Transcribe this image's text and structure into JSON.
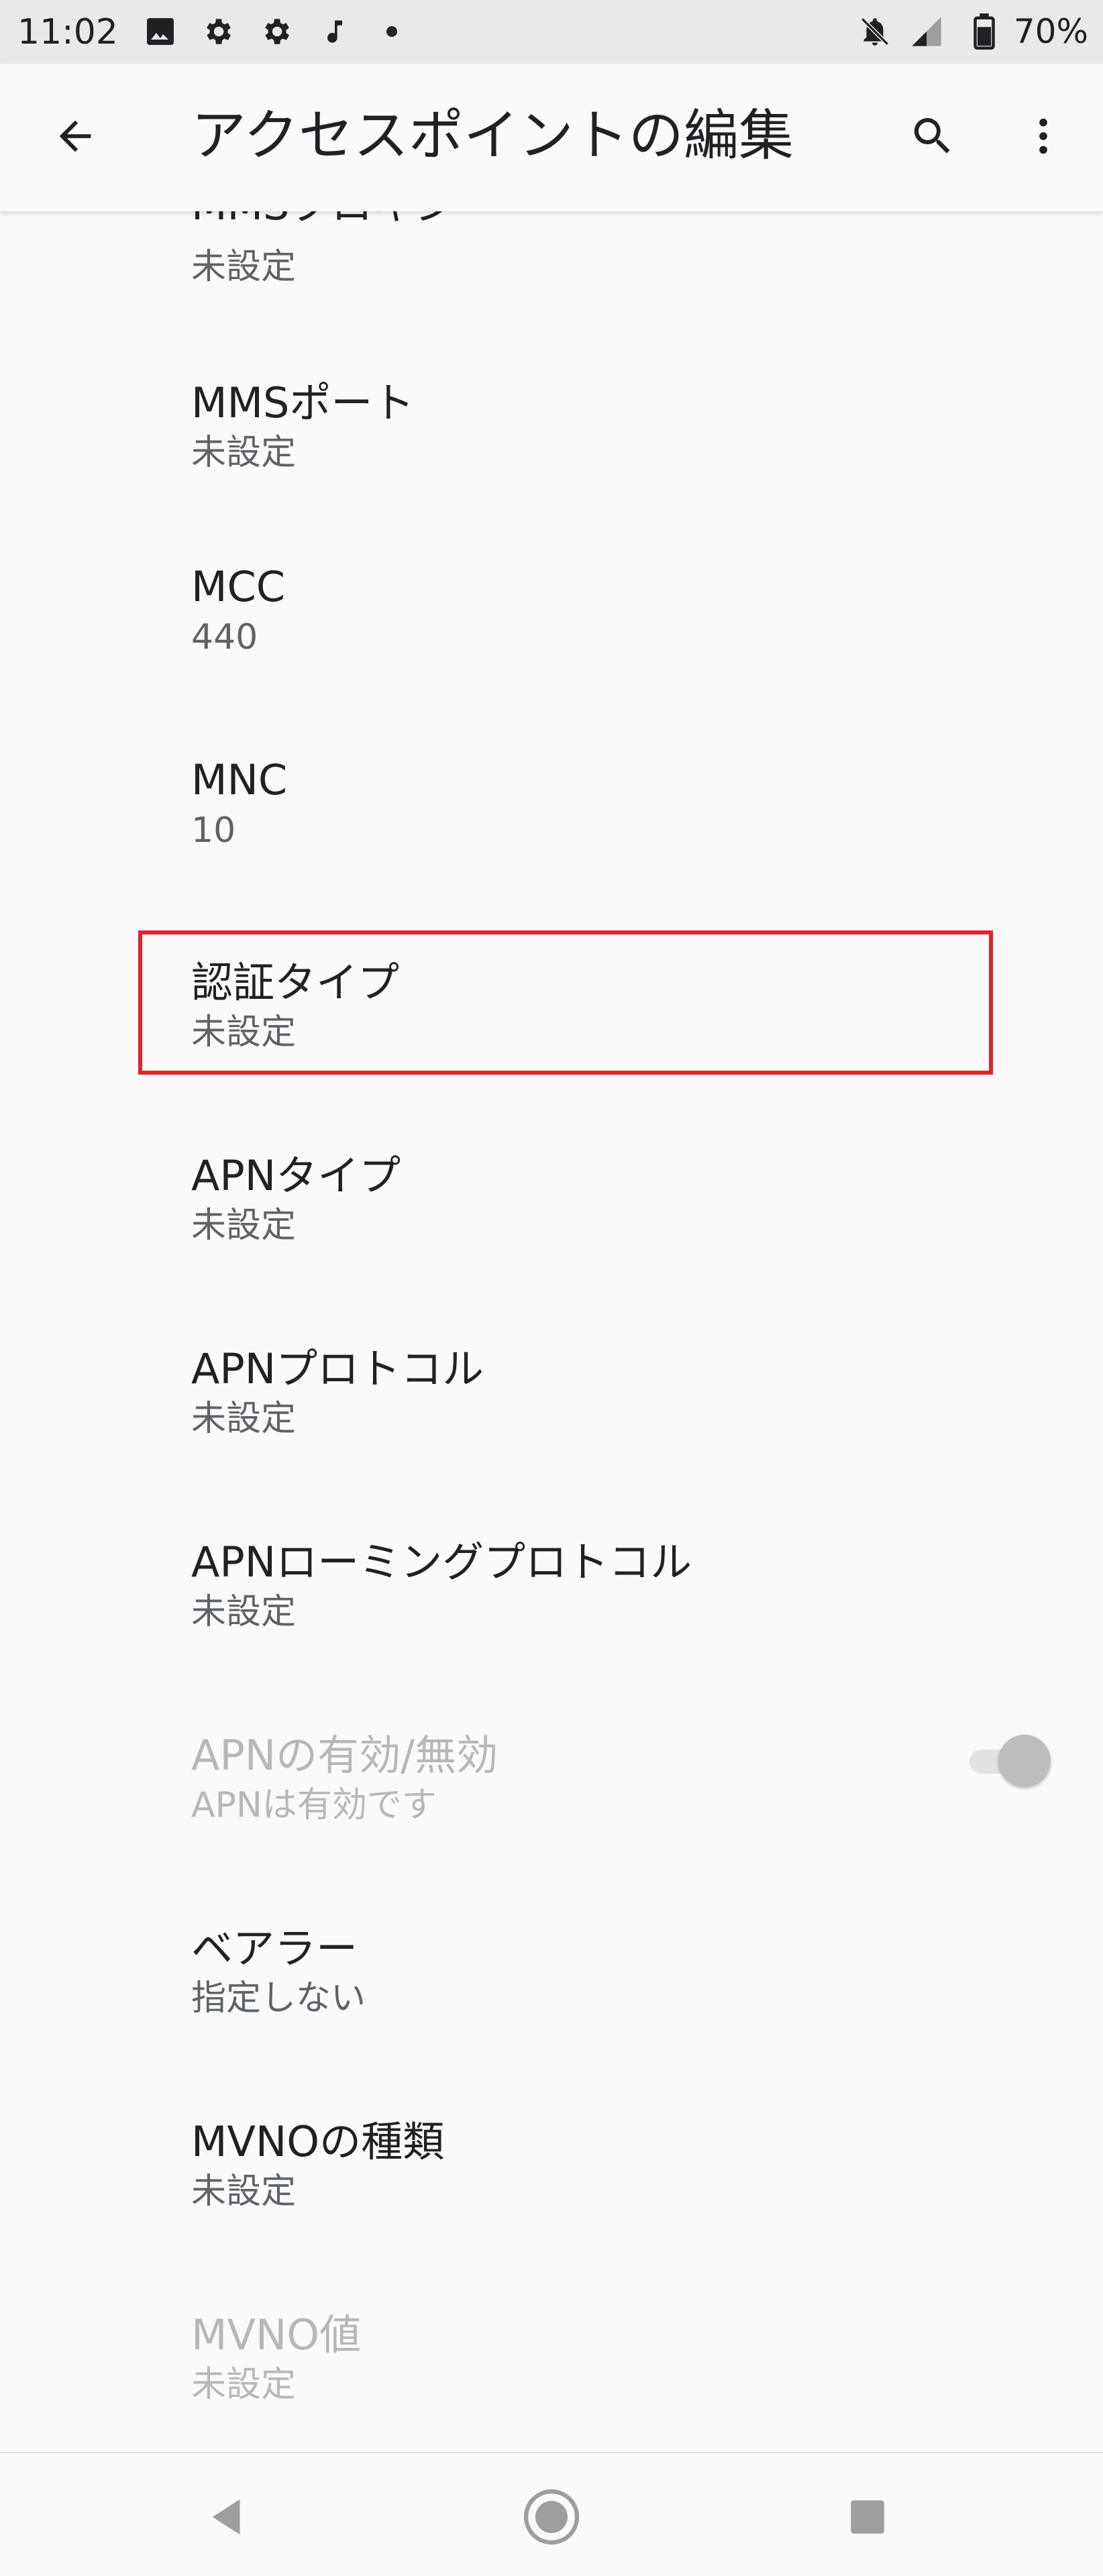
{
  "status_bar": {
    "time": "11:02",
    "battery_percent": "70%",
    "icons": [
      "image-icon",
      "gear-icon",
      "gear-icon",
      "music-note-icon",
      "dot-icon",
      "notifications-off-icon",
      "signal-icon",
      "battery-icon"
    ]
  },
  "app_bar": {
    "title": "アクセスポイントの編集",
    "icons": [
      "back-arrow-icon",
      "search-icon",
      "more-vert-icon"
    ]
  },
  "items": [
    {
      "title": "MMSプロキシ",
      "summary": "未設定"
    },
    {
      "title": "MMSポート",
      "summary": "未設定"
    },
    {
      "title": "MCC",
      "summary": "440"
    },
    {
      "title": "MNC",
      "summary": "10"
    },
    {
      "title": "認証タイプ",
      "summary": "未設定"
    },
    {
      "title": "APNタイプ",
      "summary": "未設定"
    },
    {
      "title": "APNプロトコル",
      "summary": "未設定"
    },
    {
      "title": "APNローミングプロトコル",
      "summary": "未設定"
    },
    {
      "title": "APNの有効/無効",
      "summary": "APNは有効です",
      "disabled": true,
      "toggle_on": true
    },
    {
      "title": "ベアラー",
      "summary": "指定しない"
    },
    {
      "title": "MVNOの種類",
      "summary": "未設定"
    },
    {
      "title": "MVNO値",
      "summary": "未設定",
      "disabled": true
    }
  ],
  "nav_bar": {
    "icons": [
      "nav-back-icon",
      "nav-home-icon",
      "nav-recents-icon"
    ]
  },
  "colors": {
    "highlight": "#d9262f",
    "background": "#fafafa",
    "status_bar": "#e9e9e9"
  }
}
